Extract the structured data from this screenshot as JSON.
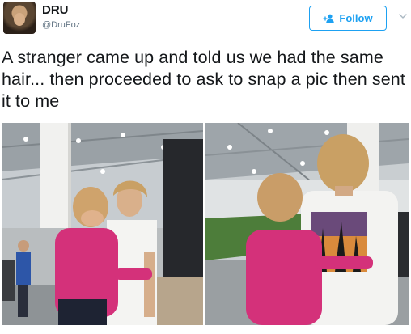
{
  "user": {
    "display_name": "DRU",
    "handle": "@DruFoz"
  },
  "actions": {
    "follow_label": "Follow"
  },
  "icons": {
    "follow": "add-person-icon",
    "menu": "chevron-down-icon"
  },
  "tweet": {
    "text": "A stranger came up and told us we had the same hair... then proceeded to ask to snap a pic then sent it to me"
  },
  "media": {
    "photo_count": 2
  },
  "colors": {
    "accent": "#1da1f2",
    "text": "#14171a",
    "secondary_text": "#657786"
  }
}
